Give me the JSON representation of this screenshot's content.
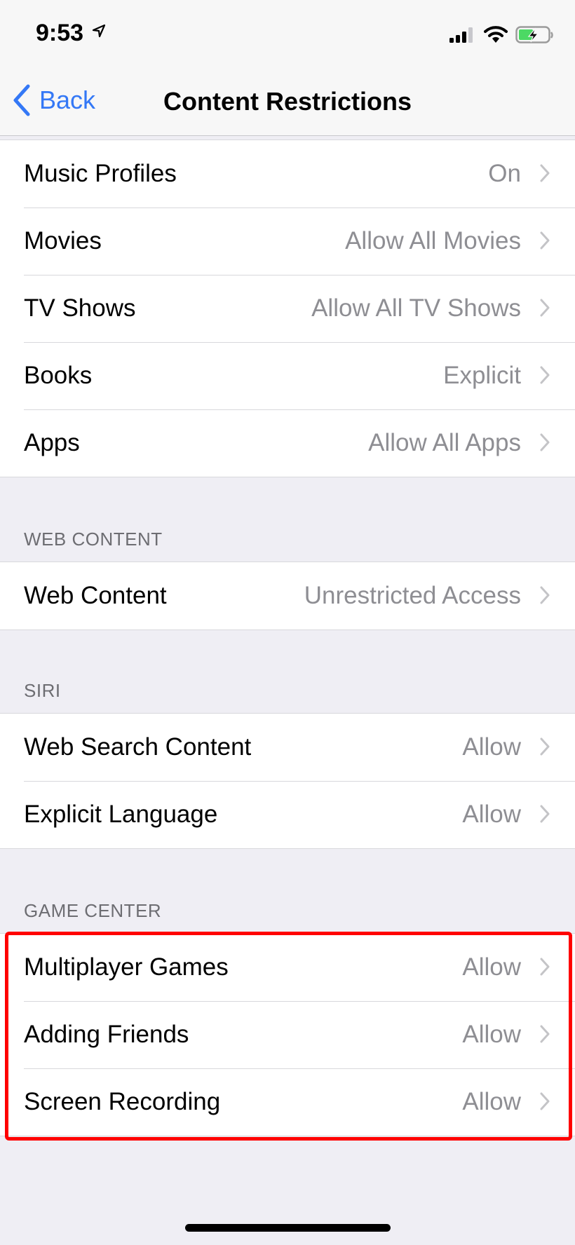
{
  "status_bar": {
    "time": "9:53",
    "icons": [
      "location-arrow-icon",
      "cellular-signal-icon",
      "wifi-icon",
      "battery-charging-icon"
    ]
  },
  "nav": {
    "back_label": "Back",
    "title": "Content Restrictions"
  },
  "sections": {
    "media": {
      "header": "",
      "rows": [
        {
          "label": "Music Profiles",
          "value": "On"
        },
        {
          "label": "Movies",
          "value": "Allow All Movies"
        },
        {
          "label": "TV Shows",
          "value": "Allow All TV Shows"
        },
        {
          "label": "Books",
          "value": "Explicit"
        },
        {
          "label": "Apps",
          "value": "Allow All Apps"
        }
      ]
    },
    "web": {
      "header": "WEB CONTENT",
      "rows": [
        {
          "label": "Web Content",
          "value": "Unrestricted Access"
        }
      ]
    },
    "siri": {
      "header": "SIRI",
      "rows": [
        {
          "label": "Web Search Content",
          "value": "Allow"
        },
        {
          "label": "Explicit Language",
          "value": "Allow"
        }
      ]
    },
    "game_center": {
      "header": "GAME CENTER",
      "rows": [
        {
          "label": "Multiplayer Games",
          "value": "Allow"
        },
        {
          "label": "Adding Friends",
          "value": "Allow"
        },
        {
          "label": "Screen Recording",
          "value": "Allow"
        }
      ]
    }
  },
  "colors": {
    "accent": "#3478f6",
    "highlight": "#ff0000",
    "battery": "#4cd964"
  }
}
